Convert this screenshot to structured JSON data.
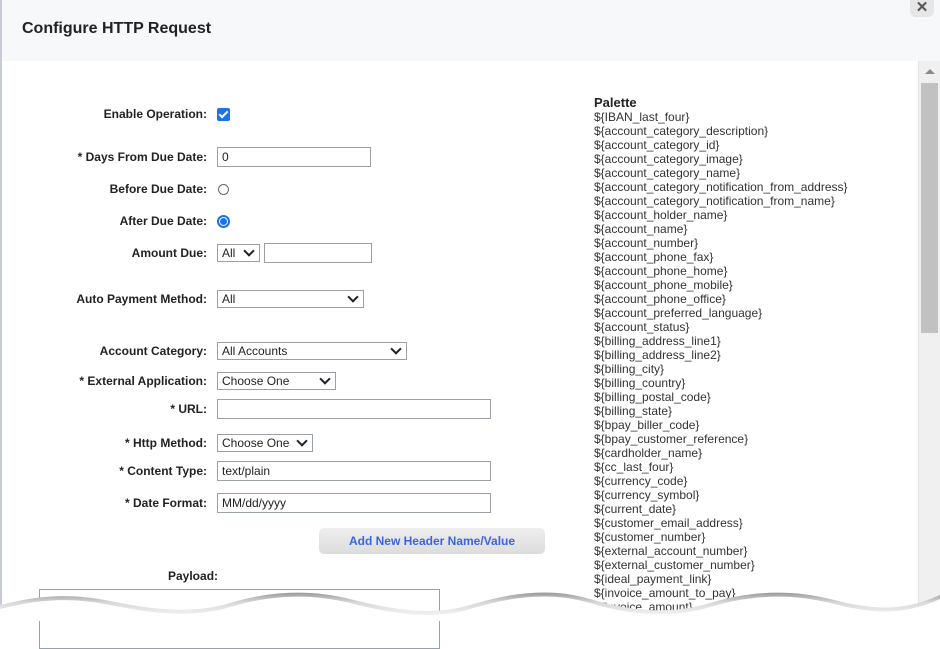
{
  "dialog": {
    "title": "Configure HTTP Request",
    "close_icon": "close-icon"
  },
  "form": {
    "enable_operation": {
      "label": "Enable Operation:",
      "checked": true
    },
    "days_from_due_date": {
      "label": "* Days From Due Date:",
      "value": "0"
    },
    "before_due_date": {
      "label": "Before Due Date:",
      "selected": false
    },
    "after_due_date": {
      "label": "After Due Date:",
      "selected": true
    },
    "amount_due": {
      "label": "Amount Due:",
      "operator": "All",
      "value": ""
    },
    "auto_payment_method": {
      "label": "Auto Payment Method:",
      "value": "All"
    },
    "account_category": {
      "label": "Account Category:",
      "value": "All Accounts"
    },
    "external_application": {
      "label": "* External Application:",
      "value": "Choose One"
    },
    "url": {
      "label": "* URL:",
      "value": ""
    },
    "http_method": {
      "label": "* Http Method:",
      "value": "Choose One"
    },
    "content_type": {
      "label": "* Content Type:",
      "value": "text/plain"
    },
    "date_format": {
      "label": "* Date Format:",
      "value": "MM/dd/yyyy"
    },
    "add_header_button": "Add New Header Name/Value",
    "payload": {
      "label": "Payload:",
      "value": ""
    }
  },
  "palette": {
    "title": "Palette",
    "items": [
      "${IBAN_last_four}",
      "${account_category_description}",
      "${account_category_id}",
      "${account_category_image}",
      "${account_category_name}",
      "${account_category_notification_from_address}",
      "${account_category_notification_from_name}",
      "${account_holder_name}",
      "${account_name}",
      "${account_number}",
      "${account_phone_fax}",
      "${account_phone_home}",
      "${account_phone_mobile}",
      "${account_phone_office}",
      "${account_preferred_language}",
      "${account_status}",
      "${billing_address_line1}",
      "${billing_address_line2}",
      "${billing_city}",
      "${billing_country}",
      "${billing_postal_code}",
      "${billing_state}",
      "${bpay_biller_code}",
      "${bpay_customer_reference}",
      "${cardholder_name}",
      "${cc_last_four}",
      "${currency_code}",
      "${currency_symbol}",
      "${current_date}",
      "${customer_email_address}",
      "${customer_number}",
      "${external_account_number}",
      "${external_customer_number}",
      "${ideal_payment_link}",
      "${invoice_amount_to_pay}",
      "${invoice_amount}"
    ]
  },
  "colors": {
    "accent": "#1a73e8",
    "button_text": "#3b64e0",
    "header_bg": "#f7f8fa"
  }
}
